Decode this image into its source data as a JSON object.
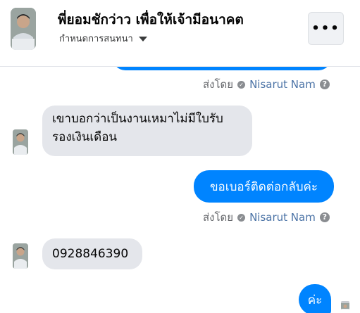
{
  "header": {
    "title": "พี่ยอมชักว่าว เพื่อให้เจ้ามีอนาคต",
    "subtitle": "กำหนดการสนทนา",
    "more_label": "•••"
  },
  "messages": [
    {
      "sentby_label": "ส่งโดย",
      "sender": "Nisarut Nam",
      "help": "?"
    },
    {
      "text_line1": "เขาบอกว่าเป็นงานเหมาไม่มีใบรับ",
      "text_line2": "รองเงินเดือน"
    },
    {
      "text": "ขอเบอร์ติดต่อกลับค่ะ"
    },
    {
      "sentby_label": "ส่งโดย",
      "sender": "Nisarut Nam",
      "help": "?"
    },
    {
      "text": "0928846390"
    },
    {
      "text": "ค่ะ"
    }
  ],
  "colors": {
    "accent": "#0084ff",
    "incoming_bubble": "#e4e6eb",
    "sender_name": "#4b73a6"
  }
}
